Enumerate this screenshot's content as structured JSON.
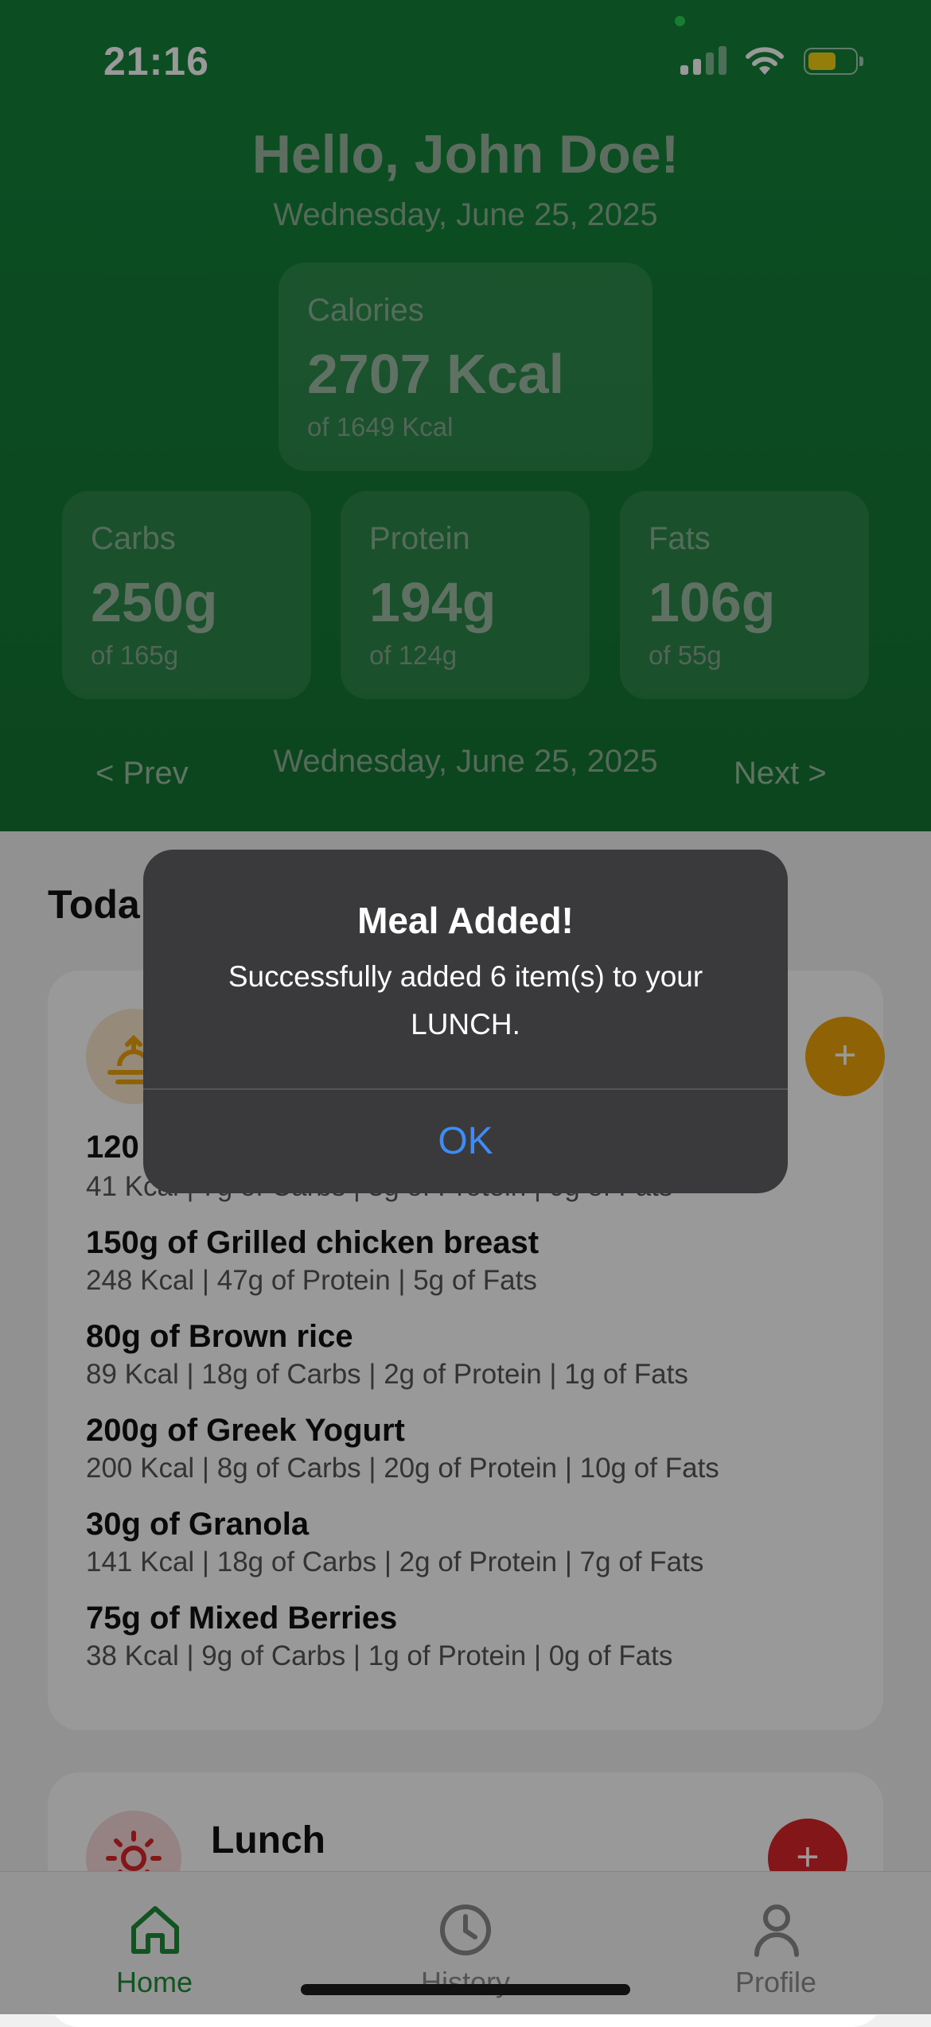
{
  "status_bar": {
    "time": "21:16",
    "battery_color": "#f5d313"
  },
  "header": {
    "greeting": "Hello, John Doe!",
    "date": "Wednesday, June 25, 2025",
    "calories": {
      "label": "Calories",
      "value": "2707 Kcal",
      "target": "of 1649 Kcal"
    },
    "macros": [
      {
        "label": "Carbs",
        "value": "250g",
        "target": "of 165g"
      },
      {
        "label": "Protein",
        "value": "194g",
        "target": "of 124g"
      },
      {
        "label": "Fats",
        "value": "106g",
        "target": "of 55g"
      }
    ],
    "nav": {
      "prev": "< Prev",
      "date": "Wednesday, June 25, 2025",
      "next": "Next >"
    }
  },
  "main": {
    "section_title": "Toda",
    "breakfast": {
      "icon": "sunrise-icon",
      "add_color": "#f0a30a",
      "items": [
        {
          "name": "120",
          "detail": "41 Kcal | 7g of Carbs | 3g of Protein | 0g of Fats"
        },
        {
          "name": "150g of Grilled chicken breast",
          "detail": "248 Kcal | 47g of Protein | 5g of Fats"
        },
        {
          "name": "80g of Brown rice",
          "detail": "89 Kcal | 18g of Carbs | 2g of Protein | 1g of Fats"
        },
        {
          "name": "200g of Greek Yogurt",
          "detail": "200 Kcal | 8g of Carbs | 20g of Protein | 10g of Fats"
        },
        {
          "name": "30g of Granola",
          "detail": "141 Kcal | 18g of Carbs | 2g of Protein | 7g of Fats"
        },
        {
          "name": "75g of Mixed Berries",
          "detail": "38 Kcal | 9g of Carbs | 1g of Protein | 0g of Fats"
        }
      ]
    },
    "lunch": {
      "title": "Lunch",
      "icon": "sun-icon",
      "add_color": "#d9262b"
    }
  },
  "tabbar": {
    "tabs": [
      {
        "label": "Home",
        "icon": "home-icon",
        "active": true
      },
      {
        "label": "History",
        "icon": "clock-icon",
        "active": false
      },
      {
        "label": "Profile",
        "icon": "person-icon",
        "active": false
      }
    ],
    "active_color": "#1e8a3a"
  },
  "alert": {
    "title": "Meal Added!",
    "message": "Successfully added 6 item(s) to your LUNCH.",
    "ok": "OK"
  }
}
